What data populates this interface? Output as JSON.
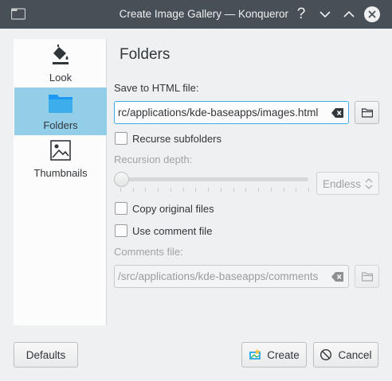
{
  "window": {
    "title": "Create Image Gallery — Konqueror",
    "help_glyph": "?",
    "app_icon": "folder-icon"
  },
  "sidebar": {
    "items": [
      {
        "label": "Look",
        "icon": "paint-bucket-icon",
        "selected": false
      },
      {
        "label": "Folders",
        "icon": "folder-icon",
        "selected": true
      },
      {
        "label": "Thumbnails",
        "icon": "image-icon",
        "selected": false
      }
    ]
  },
  "page": {
    "title": "Folders",
    "save_label": "Save to HTML file:",
    "save_value": "rc/applications/kde-baseapps/images.html",
    "recurse_label": "Recurse subfolders",
    "recurse_checked": false,
    "depth_label": "Recursion depth:",
    "depth_value": "Endless",
    "depth_slider_fraction": 0,
    "copy_label": "Copy original files",
    "copy_checked": false,
    "comment_label": "Use comment file",
    "comment_checked": false,
    "comments_label": "Comments file:",
    "comments_value": "/src/applications/kde-baseapps/comments"
  },
  "buttons": {
    "defaults": "Defaults",
    "create": "Create",
    "cancel": "Cancel"
  },
  "colors": {
    "accent": "#3daee9",
    "selection": "#93cee9",
    "titlebar": "#475057"
  }
}
